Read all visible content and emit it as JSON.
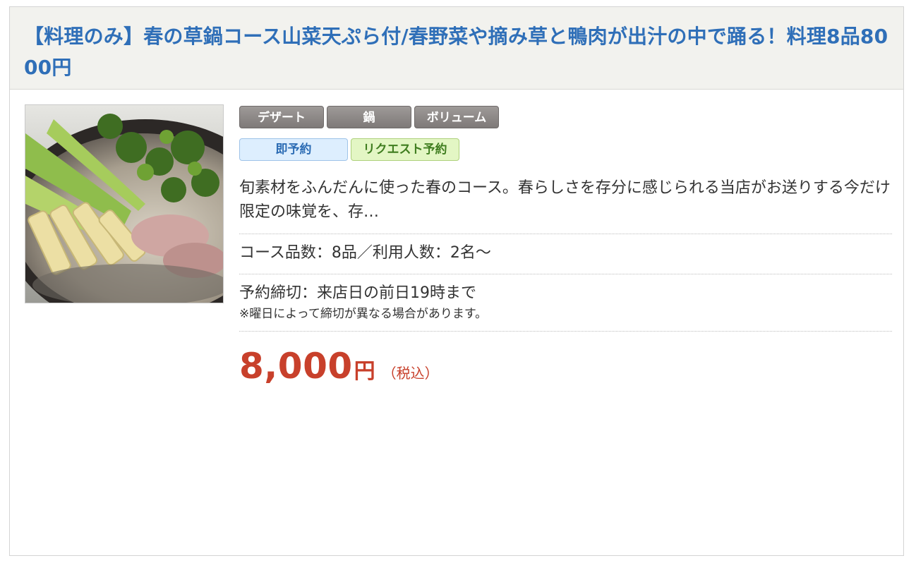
{
  "course": {
    "title": "【料理のみ】春の草鍋コース山菜天ぷら付/春野菜や摘み草と鴨肉が出汁の中で踊る！料理8品8000円"
  },
  "photo": {
    "alt": "鍋"
  },
  "tags": [
    "デザート",
    "鍋",
    "ボリューム"
  ],
  "booking": {
    "instant": "即予約",
    "request": "リクエスト予約"
  },
  "description": "旬素材をふんだんに使った春のコース。春らしさを存分に感じられる当店がお送りする今だけ限定の味覚を、存…",
  "info": {
    "count": "コース品数：8品／利用人数：2名～",
    "deadline": "予約締切：来店日の前日19時まで",
    "deadline_note": "※曜日によって締切が異なる場合があります。"
  },
  "price": {
    "amount": "8,000",
    "unit": "円",
    "tax": "（税込）"
  },
  "colors": {
    "title": "#2f6fb8",
    "price": "#c8402b",
    "tag": "#8a8584",
    "header_bg": "#f2f2ee"
  }
}
